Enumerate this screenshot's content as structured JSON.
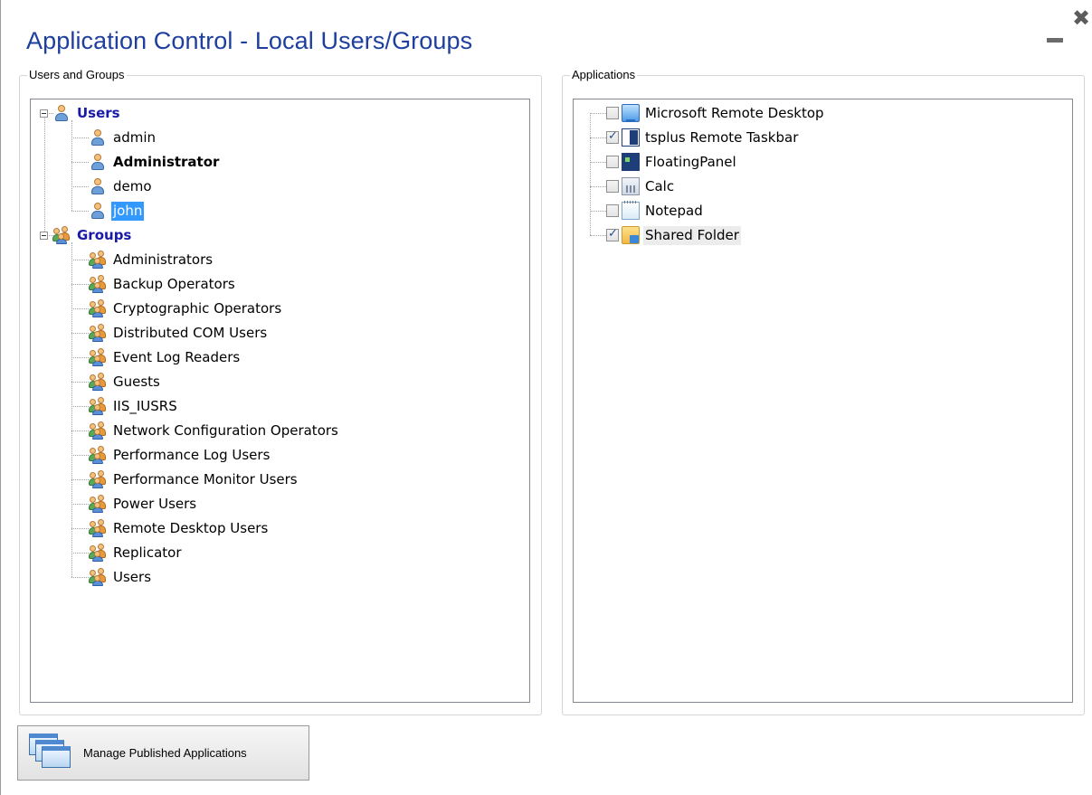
{
  "window": {
    "title": "Application Control - Local Users/Groups",
    "minimize_icon": "minimize-icon",
    "close_icon": "close-icon"
  },
  "users_groups": {
    "legend": "Users and Groups",
    "users_header": "Users",
    "users": [
      {
        "label": "admin",
        "bold": false,
        "selected": false
      },
      {
        "label": "Administrator",
        "bold": true,
        "selected": false
      },
      {
        "label": "demo",
        "bold": false,
        "selected": false
      },
      {
        "label": "john",
        "bold": false,
        "selected": true
      }
    ],
    "groups_header": "Groups",
    "groups": [
      "Administrators",
      "Backup Operators",
      "Cryptographic Operators",
      "Distributed COM Users",
      "Event Log Readers",
      "Guests",
      "IIS_IUSRS",
      "Network Configuration Operators",
      "Performance Log Users",
      "Performance Monitor Users",
      "Power Users",
      "Remote Desktop Users",
      "Replicator",
      "Users"
    ]
  },
  "applications": {
    "legend": "Applications",
    "items": [
      {
        "label": "Microsoft Remote Desktop",
        "checked": false,
        "icon": "remote-desktop-icon"
      },
      {
        "label": "tsplus Remote Taskbar",
        "checked": true,
        "icon": "taskbar-icon"
      },
      {
        "label": "FloatingPanel",
        "checked": false,
        "icon": "floating-panel-icon"
      },
      {
        "label": "Calc",
        "checked": false,
        "icon": "calculator-icon"
      },
      {
        "label": "Notepad",
        "checked": false,
        "icon": "notepad-icon"
      },
      {
        "label": "Shared Folder",
        "checked": true,
        "icon": "shared-folder-icon"
      }
    ]
  },
  "footer": {
    "manage_button_label": "Manage Published Applications"
  }
}
